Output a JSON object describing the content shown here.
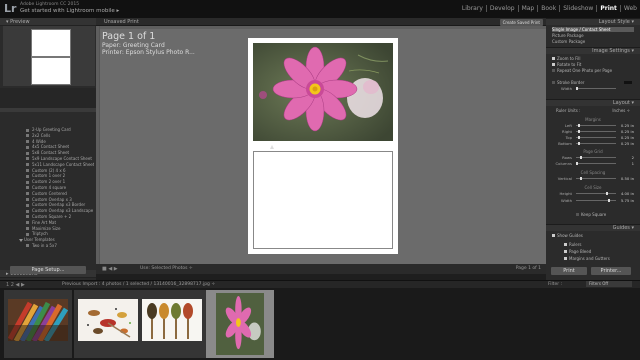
{
  "app": {
    "brand_line1": "Adobe Lightroom CC 2015",
    "brand_line2": "Get started with Lightroom mobile  ▸",
    "modules": [
      "Library",
      "Develop",
      "Map",
      "Book",
      "Slideshow",
      "Print",
      "Web"
    ],
    "active_module": "Print"
  },
  "left_panel": {
    "preview_label": "Preview",
    "templates": [
      {
        "label": "2-Up Greeting Card",
        "folder": false
      },
      {
        "label": "2x2 Cells",
        "folder": false
      },
      {
        "label": "4 Wide",
        "folder": false
      },
      {
        "label": "4x5 Contact Sheet",
        "folder": false
      },
      {
        "label": "5x8 Contact Sheet",
        "folder": false
      },
      {
        "label": "5x9 Landscape Contact Sheet",
        "folder": false
      },
      {
        "label": "5x11 Landscape Contact Sheet",
        "folder": false
      },
      {
        "label": "Custom (2) 4 x 6",
        "folder": false
      },
      {
        "label": "Custom 1 over 2",
        "folder": false
      },
      {
        "label": "Custom 2 over 1",
        "folder": false
      },
      {
        "label": "Custom 4 square",
        "folder": false
      },
      {
        "label": "Custom Centered",
        "folder": false
      },
      {
        "label": "Custom Overlap x 3",
        "folder": false
      },
      {
        "label": "Custom Overlap x3 Border",
        "folder": false
      },
      {
        "label": "Custom Overlap x3 Landscape",
        "folder": false
      },
      {
        "label": "Custom Square + 2",
        "folder": false
      },
      {
        "label": "Fine Art Mat",
        "folder": false
      },
      {
        "label": "Maximize Size",
        "folder": false
      },
      {
        "label": "Triptych",
        "folder": false
      },
      {
        "label": "User Templates",
        "folder": true
      },
      {
        "label": "Two in a 5x7",
        "folder": false
      }
    ],
    "collections_label": "Collections",
    "page_setup_label": "Page Setup..."
  },
  "center": {
    "unsaved_label": "Unsaved Print",
    "create_saved_label": "Create Saved Print",
    "page_title": "Page 1 of 1",
    "paper_line": "Paper:  Greeting Card",
    "printer_line": "Printer:  Epson Stylus Photo R...",
    "toolbar_icons": "■  ◀  ▶",
    "use_label": "Use:  Selected Photos  ÷",
    "page_count": "Page 1 of 1"
  },
  "right_panel": {
    "layout_style_label": "Layout Style",
    "layout_styles": [
      "Single Image / Contact Sheet",
      "Picture Package",
      "Custom Package"
    ],
    "selected_layout_style": "Single Image / Contact Sheet",
    "image_settings_label": "Image Settings",
    "image_settings": [
      {
        "label": "Zoom to Fill",
        "checked": true
      },
      {
        "label": "Rotate to Fit",
        "checked": true
      },
      {
        "label": "Repeat One Photo per Page",
        "checked": false
      }
    ],
    "stroke_border_label": "Stroke Border",
    "width_label": "Width",
    "layout_label": "Layout",
    "ruler_units_label": "Ruler Units :",
    "ruler_units_value": "Inches ÷",
    "margins_label": "Margins",
    "margins": [
      {
        "label": "Left",
        "value": "0.25 in",
        "fraction": 0.05
      },
      {
        "label": "Right",
        "value": "0.25 in",
        "fraction": 0.05
      },
      {
        "label": "Top",
        "value": "0.25 in",
        "fraction": 0.05
      },
      {
        "label": "Bottom",
        "value": "0.25 in",
        "fraction": 0.05
      }
    ],
    "page_grid_label": "Page Grid",
    "page_grid": [
      {
        "label": "Rows",
        "value": "2",
        "fraction": 0.1
      },
      {
        "label": "Columns",
        "value": "1",
        "fraction": 0.0
      }
    ],
    "cell_spacing_label": "Cell Spacing",
    "cell_spacing": [
      {
        "label": "Vertical",
        "value": "0.50 in",
        "fraction": 0.1
      }
    ],
    "cell_size_label": "Cell Size",
    "cell_size": [
      {
        "label": "Height",
        "value": "4.00 in",
        "fraction": 0.8
      },
      {
        "label": "Width",
        "value": "5.75 in",
        "fraction": 0.85
      }
    ],
    "keep_square_label": "Keep Square",
    "guides_label": "Guides",
    "show_guides_label": "Show Guides",
    "guides": [
      {
        "label": "Rulers",
        "checked": true
      },
      {
        "label": "Page Bleed",
        "checked": true
      },
      {
        "label": "Margins and Gutters",
        "checked": true
      }
    ],
    "print_label": "Print",
    "printer_label": "Printer..."
  },
  "filmstrip": {
    "nav_icons": "1  2  ◀  ▶",
    "previous_import": "Previous Import",
    "source": "4 photos / 1 selected / 13140016_32898717.jpg ÷",
    "filter_label": "Filter :",
    "filter_value": "Filters Off",
    "thumbnails": [
      {
        "name": "pencils",
        "selected": false
      },
      {
        "name": "spices",
        "selected": false
      },
      {
        "name": "spoons",
        "selected": false
      },
      {
        "name": "flower",
        "selected": true
      }
    ]
  },
  "colors": {
    "flower_petal": "#e06ab0",
    "flower_center": "#f3c51b",
    "background": "#1e1e1e",
    "canvas": "#6b6b6b"
  }
}
